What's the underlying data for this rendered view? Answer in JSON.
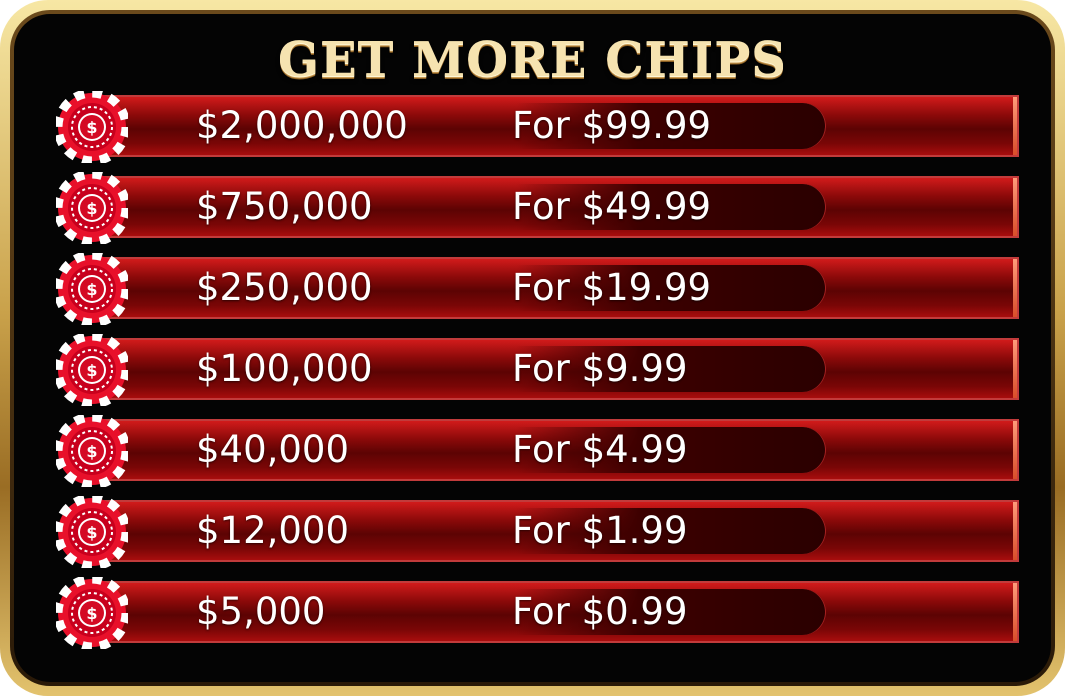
{
  "store": {
    "title": "GET MORE CHIPS",
    "chip_icon": "dollar-chip-icon",
    "colors": {
      "bar_red": "#8e0a0a",
      "gold": "#c9a14a",
      "title": "#f6e3b0"
    },
    "offers": [
      {
        "amount": "$2,000,000",
        "price": "For $99.99"
      },
      {
        "amount": "$750,000",
        "price": "For $49.99"
      },
      {
        "amount": "$250,000",
        "price": "For $19.99"
      },
      {
        "amount": "$100,000",
        "price": "For $9.99"
      },
      {
        "amount": "$40,000",
        "price": "For $4.99"
      },
      {
        "amount": "$12,000",
        "price": "For $1.99"
      },
      {
        "amount": "$5,000",
        "price": "For $0.99"
      }
    ]
  }
}
